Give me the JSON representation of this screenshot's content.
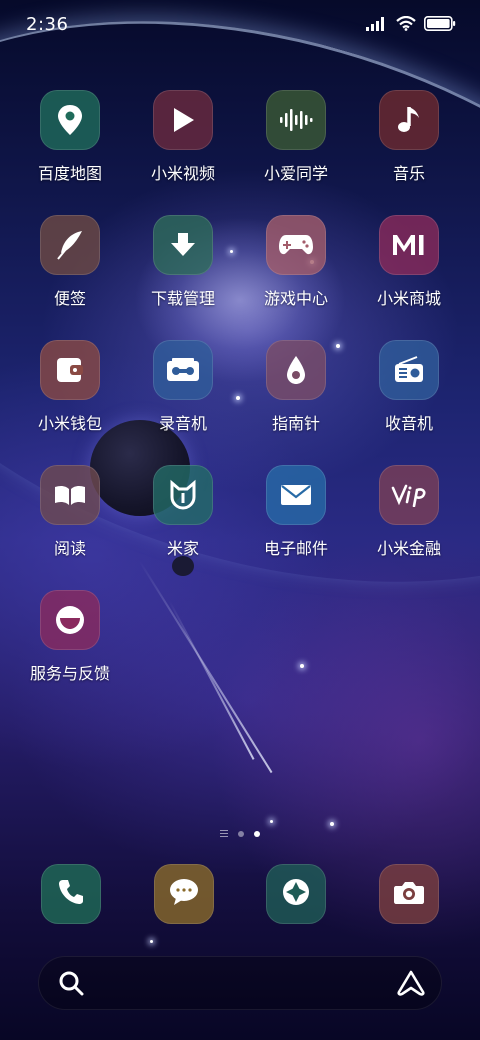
{
  "status_bar": {
    "time": "2:36",
    "icons": [
      "signal-icon",
      "wifi-icon",
      "battery-icon"
    ]
  },
  "apps": [
    {
      "label": "百度地图",
      "icon": "location-pin-icon",
      "bg": "#1f6b5a"
    },
    {
      "label": "小米视频",
      "icon": "play-icon",
      "bg": "#6b2a3f"
    },
    {
      "label": "小爱同学",
      "icon": "sound-wave-icon",
      "bg": "#3b5a34"
    },
    {
      "label": "音乐",
      "icon": "music-note-icon",
      "bg": "#6e2a2f"
    },
    {
      "label": "便签",
      "icon": "feather-icon",
      "bg": "#6e4a44"
    },
    {
      "label": "下载管理",
      "icon": "download-arrow-icon",
      "bg": "#2e6b5a"
    },
    {
      "label": "游戏中心",
      "icon": "gamepad-icon",
      "bg": "#a35c6a"
    },
    {
      "label": "小米商城",
      "icon": "mi-logo-icon",
      "bg": "#8a2a5a"
    },
    {
      "label": "小米钱包",
      "icon": "wallet-icon",
      "bg": "#8a4a44"
    },
    {
      "label": "录音机",
      "icon": "cassette-icon",
      "bg": "#2f5c9a"
    },
    {
      "label": "指南针",
      "icon": "compass-drop-icon",
      "bg": "#7a4c66"
    },
    {
      "label": "收音机",
      "icon": "radio-icon",
      "bg": "#2f5c9a"
    },
    {
      "label": "阅读",
      "icon": "book-icon",
      "bg": "#6e4a50"
    },
    {
      "label": "米家",
      "icon": "mijia-icon",
      "bg": "#236c66"
    },
    {
      "label": "电子邮件",
      "icon": "mail-icon",
      "bg": "#276aa6"
    },
    {
      "label": "小米金融",
      "icon": "vip-icon",
      "bg": "#7a3e56"
    },
    {
      "label": "服务与反馈",
      "icon": "smile-icon",
      "bg": "#8a2a5e"
    }
  ],
  "dock": [
    {
      "icon": "phone-icon",
      "bg": "#1f6b56"
    },
    {
      "icon": "message-bubble-icon",
      "bg": "#8a6a2a"
    },
    {
      "icon": "camera-shutter-icon",
      "bg": "#1f5c56"
    },
    {
      "icon": "camera-icon",
      "bg": "#7a3e3e"
    }
  ],
  "page_indicator": {
    "pages": 2,
    "active": 1
  },
  "search": {
    "icon": "search-icon",
    "assistant_icon": "assistant-icon"
  }
}
